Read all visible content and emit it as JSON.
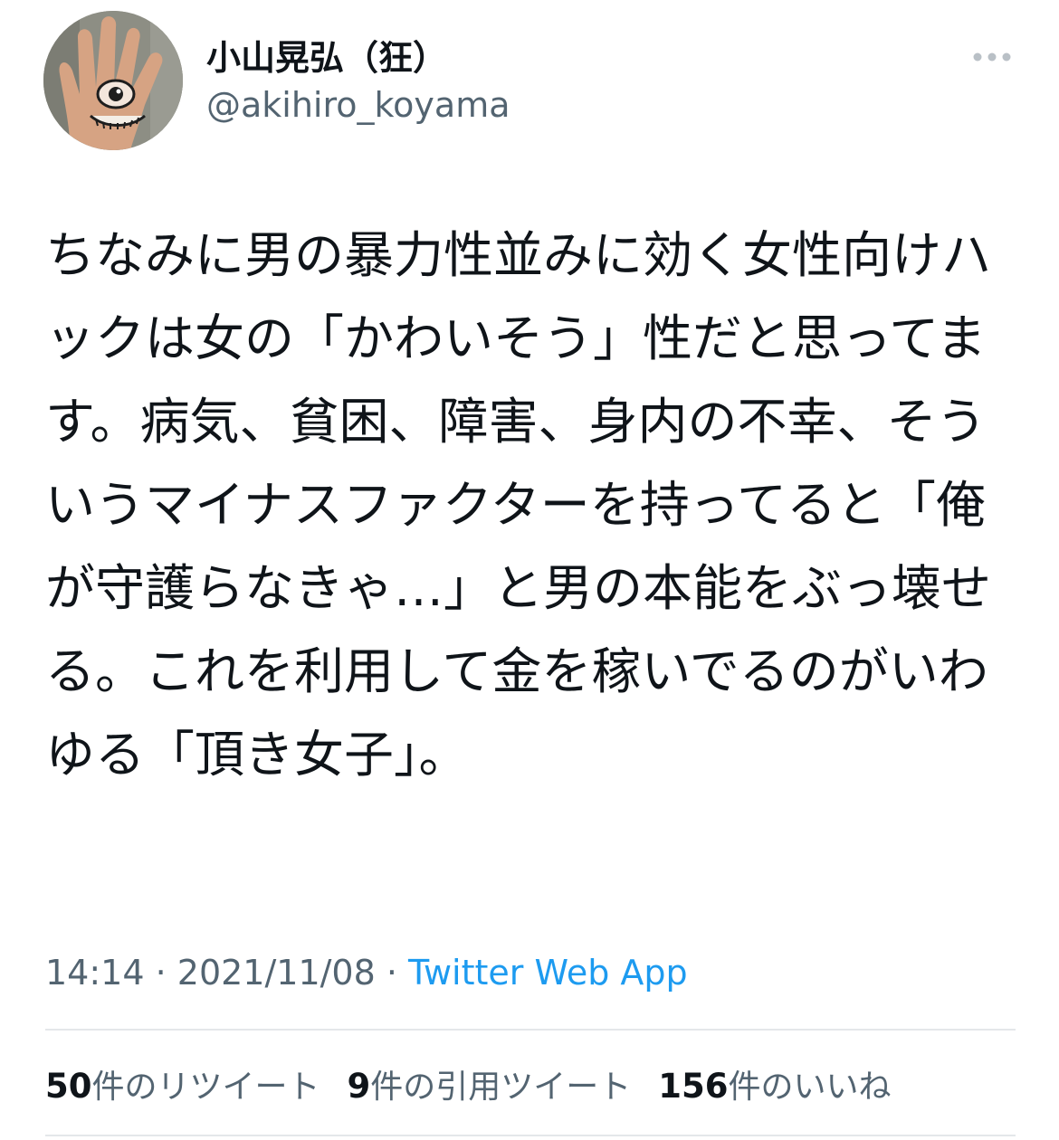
{
  "user": {
    "display_name": "小山晃弘（狂）",
    "handle": "@akihiro_koyama",
    "avatar_icon": "hand-eye-avatar"
  },
  "menu": {
    "icon": "more-dots-icon"
  },
  "tweet": {
    "text": "ちなみに男の暴力性並みに効く女性向けハックは女の「かわいそう」性だと思ってます。病気、貧困、障害、身内の不幸、そういうマイナスファクターを持ってると「俺が守護らなきゃ…」と男の本能をぶっ壊せる。これを利用して金を稼いでるのがいわゆる「頂き女子」。"
  },
  "meta": {
    "time": "14:14",
    "separator1": " · ",
    "date": "2021/11/08",
    "separator2": " · ",
    "source": "Twitter Web App"
  },
  "stats": {
    "retweets": {
      "count": "50",
      "label": "件のリツイート"
    },
    "quotes": {
      "count": "9",
      "label": "件の引用ツイート"
    },
    "likes": {
      "count": "156",
      "label": "件のいいね"
    }
  },
  "colors": {
    "text": "#0f1419",
    "secondary": "#536471",
    "link": "#1d9bf0",
    "divider": "#e4e7ea"
  }
}
